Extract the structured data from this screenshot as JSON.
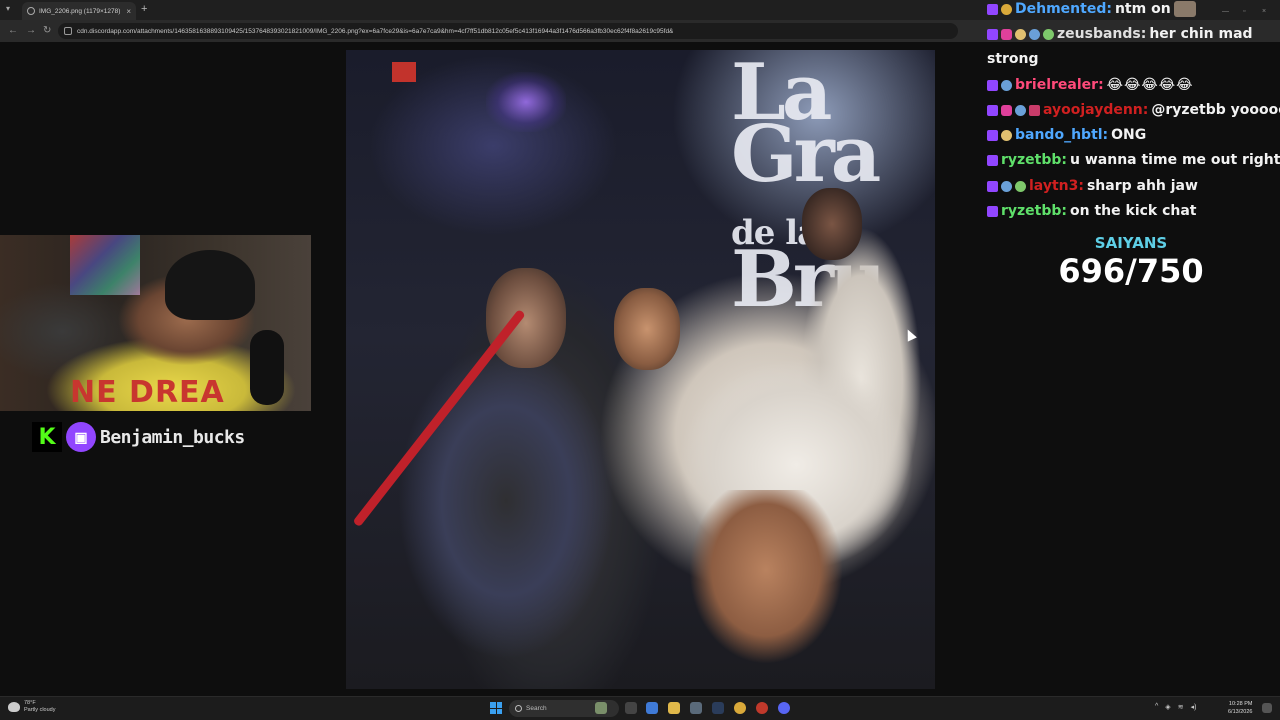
{
  "browser": {
    "tab_title": "IMG_2206.png (1179×1278)",
    "tab_close": "×",
    "new_tab": "+",
    "url": "cdn.discordapp.com/attachments/1463581638893109425/1537648393021821009/IMG_2206.png?ex=6a7fce29&is=6a7e7ca9&hm=4cf7ff51db812c05ef5c413f16944a3f1476d566a3fb30ec62f4f8a2619c95fd&"
  },
  "stream": {
    "handle": "Benjamin_bucks",
    "kick_logo": "K"
  },
  "webcam": {
    "shirt_text": "NE DREA"
  },
  "chat": {
    "messages": [
      {
        "user": "Dehmented:",
        "text": "ntm on",
        "user_color": "#4fa8ff"
      },
      {
        "user": "zeusbands:",
        "text": "her chin mad",
        "user_color": "#e0e0e0"
      },
      {
        "user": "",
        "text": "strong",
        "user_color": "#e0e0e0"
      },
      {
        "user": "brielrealer:",
        "text": "😂😂😂😂😂",
        "user_color": "#ff4a7a"
      },
      {
        "user": "ayoojaydenn:",
        "text": "@ryzetbb yoooooo",
        "user_color": "#d02020"
      },
      {
        "user": "bando_hbtl:",
        "text": "ONG",
        "user_color": "#4fa8ff"
      },
      {
        "user": "ryzetbb:",
        "text": "u wanna time me out right",
        "user_color": "#5fe06a"
      },
      {
        "user": "laytn3:",
        "text": "sharp ahh jaw",
        "user_color": "#d02020"
      },
      {
        "user": "ryzetbb:",
        "text": "on the kick chat",
        "user_color": "#5fe06a"
      }
    ]
  },
  "goal": {
    "label": "SAIYANS",
    "value": "696/750"
  },
  "window_controls": {
    "minimize": "—",
    "maximize": "▫",
    "close": "×"
  },
  "taskbar": {
    "weather_temp": "78°F",
    "weather_desc": "Partly cloudy",
    "search_placeholder": "Search",
    "time": "10:28 PM",
    "date": "6/13/2026"
  }
}
